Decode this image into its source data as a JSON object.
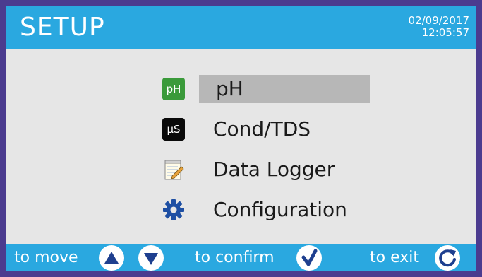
{
  "header": {
    "title": "SETUP",
    "date": "02/09/2017",
    "time": "12:05:57"
  },
  "menu": {
    "items": [
      {
        "label": "pH",
        "icon": "ph-icon",
        "icon_text": "pH",
        "selected": true
      },
      {
        "label": "Cond/TDS",
        "icon": "conductivity-icon",
        "icon_text": "µS",
        "selected": false
      },
      {
        "label": "Data Logger",
        "icon": "notepad-icon",
        "selected": false
      },
      {
        "label": "Configuration",
        "icon": "gear-icon",
        "selected": false
      }
    ]
  },
  "footer": {
    "move_label": "to move",
    "confirm_label": "to confirm",
    "exit_label": "to exit",
    "icons": [
      "up-arrow-icon",
      "down-arrow-icon",
      "checkmark-icon",
      "refresh-icon"
    ]
  },
  "colors": {
    "header": "#2aa8e0",
    "frame": "#4b3b8f",
    "background": "#e6e6e6",
    "highlight": "#b7b7b7",
    "ph_badge": "#3a9a3a",
    "icon_blue": "#1e4fa3"
  }
}
